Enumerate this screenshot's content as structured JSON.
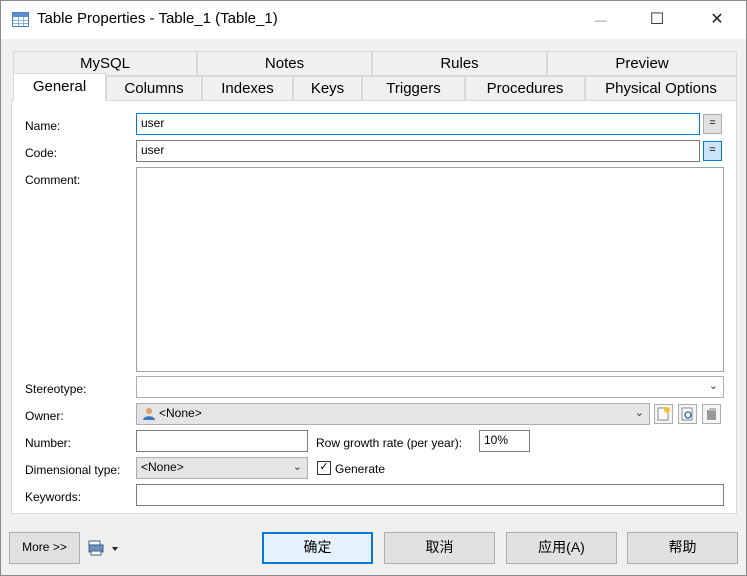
{
  "window": {
    "title": "Table Properties - Table_1 (Table_1)",
    "min_symbol": "—",
    "max_symbol": "☐",
    "close_symbol": "✕"
  },
  "tabs_row1": [
    "MySQL",
    "Notes",
    "Rules",
    "Preview"
  ],
  "tabs_row2": [
    "General",
    "Columns",
    "Indexes",
    "Keys",
    "Triggers",
    "Procedures",
    "Physical Options"
  ],
  "active_tab": "General",
  "general": {
    "name_label": "Name:",
    "name_value": "user",
    "code_label": "Code:",
    "code_value": "user",
    "equal_button": "=",
    "comment_label": "Comment:",
    "stereotype_label": "Stereotype:",
    "stereotype_value": "",
    "owner_label": "Owner:",
    "owner_value": "<None>",
    "number_label": "Number:",
    "number_value": "",
    "growth_label": "Row growth rate (per year):",
    "growth_value": "10%",
    "dimensional_label": "Dimensional type:",
    "dimensional_value": "<None>",
    "generate_label": "Generate",
    "generate_checked": true,
    "keywords_label": "Keywords:",
    "keywords_value": ""
  },
  "footer": {
    "more_button": "More >>",
    "ok_button": "确定",
    "cancel_button": "取消",
    "apply_button": "应用(A)",
    "help_button": "帮助"
  },
  "colors": {
    "accent": "#0078d7",
    "background": "#f0f0f0"
  }
}
